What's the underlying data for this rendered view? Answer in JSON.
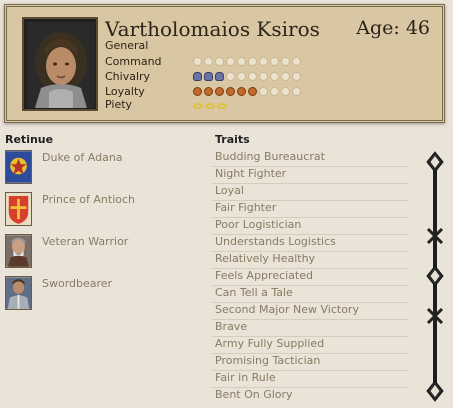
{
  "character": {
    "name": "Vartholomaios Ksiros",
    "age_label": "Age: 46"
  },
  "stats": [
    {
      "label": "General",
      "filled": 0,
      "total": 0,
      "kind": "none"
    },
    {
      "label": "Command",
      "filled": 0,
      "total": 10,
      "kind": "command"
    },
    {
      "label": "Chivalry",
      "filled": 3,
      "total": 10,
      "kind": "chiv"
    },
    {
      "label": "Loyalty",
      "filled": 6,
      "total": 10,
      "kind": "loyal"
    },
    {
      "label": "Piety",
      "filled": 3,
      "total": 3,
      "kind": "piety"
    }
  ],
  "retinue": {
    "heading": "Retinue",
    "items": [
      {
        "label": "Duke of Adana",
        "icon": "duke-of-adana-icon"
      },
      {
        "label": "Prince of Antioch",
        "icon": "prince-of-antioch-icon"
      },
      {
        "label": "Veteran Warrior",
        "icon": "veteran-warrior-icon"
      },
      {
        "label": "Swordbearer",
        "icon": "swordbearer-icon"
      }
    ]
  },
  "traits": {
    "heading": "Traits",
    "items": [
      "Budding Bureaucrat",
      "Night Fighter",
      "Loyal",
      "Fair Fighter",
      "Poor Logistician",
      "Understands Logistics",
      "Relatively Healthy",
      "Feels Appreciated",
      "Can Tell a Tale",
      "Second Major New Victory",
      "Brave",
      "Army Fully Supplied",
      "Promising Tactician",
      "Fair in Rule",
      "Bent On Glory"
    ]
  },
  "colors": {
    "parchment": "#d8c7a2",
    "panel": "#e9e3d8",
    "muted_text": "#8a7b62"
  }
}
